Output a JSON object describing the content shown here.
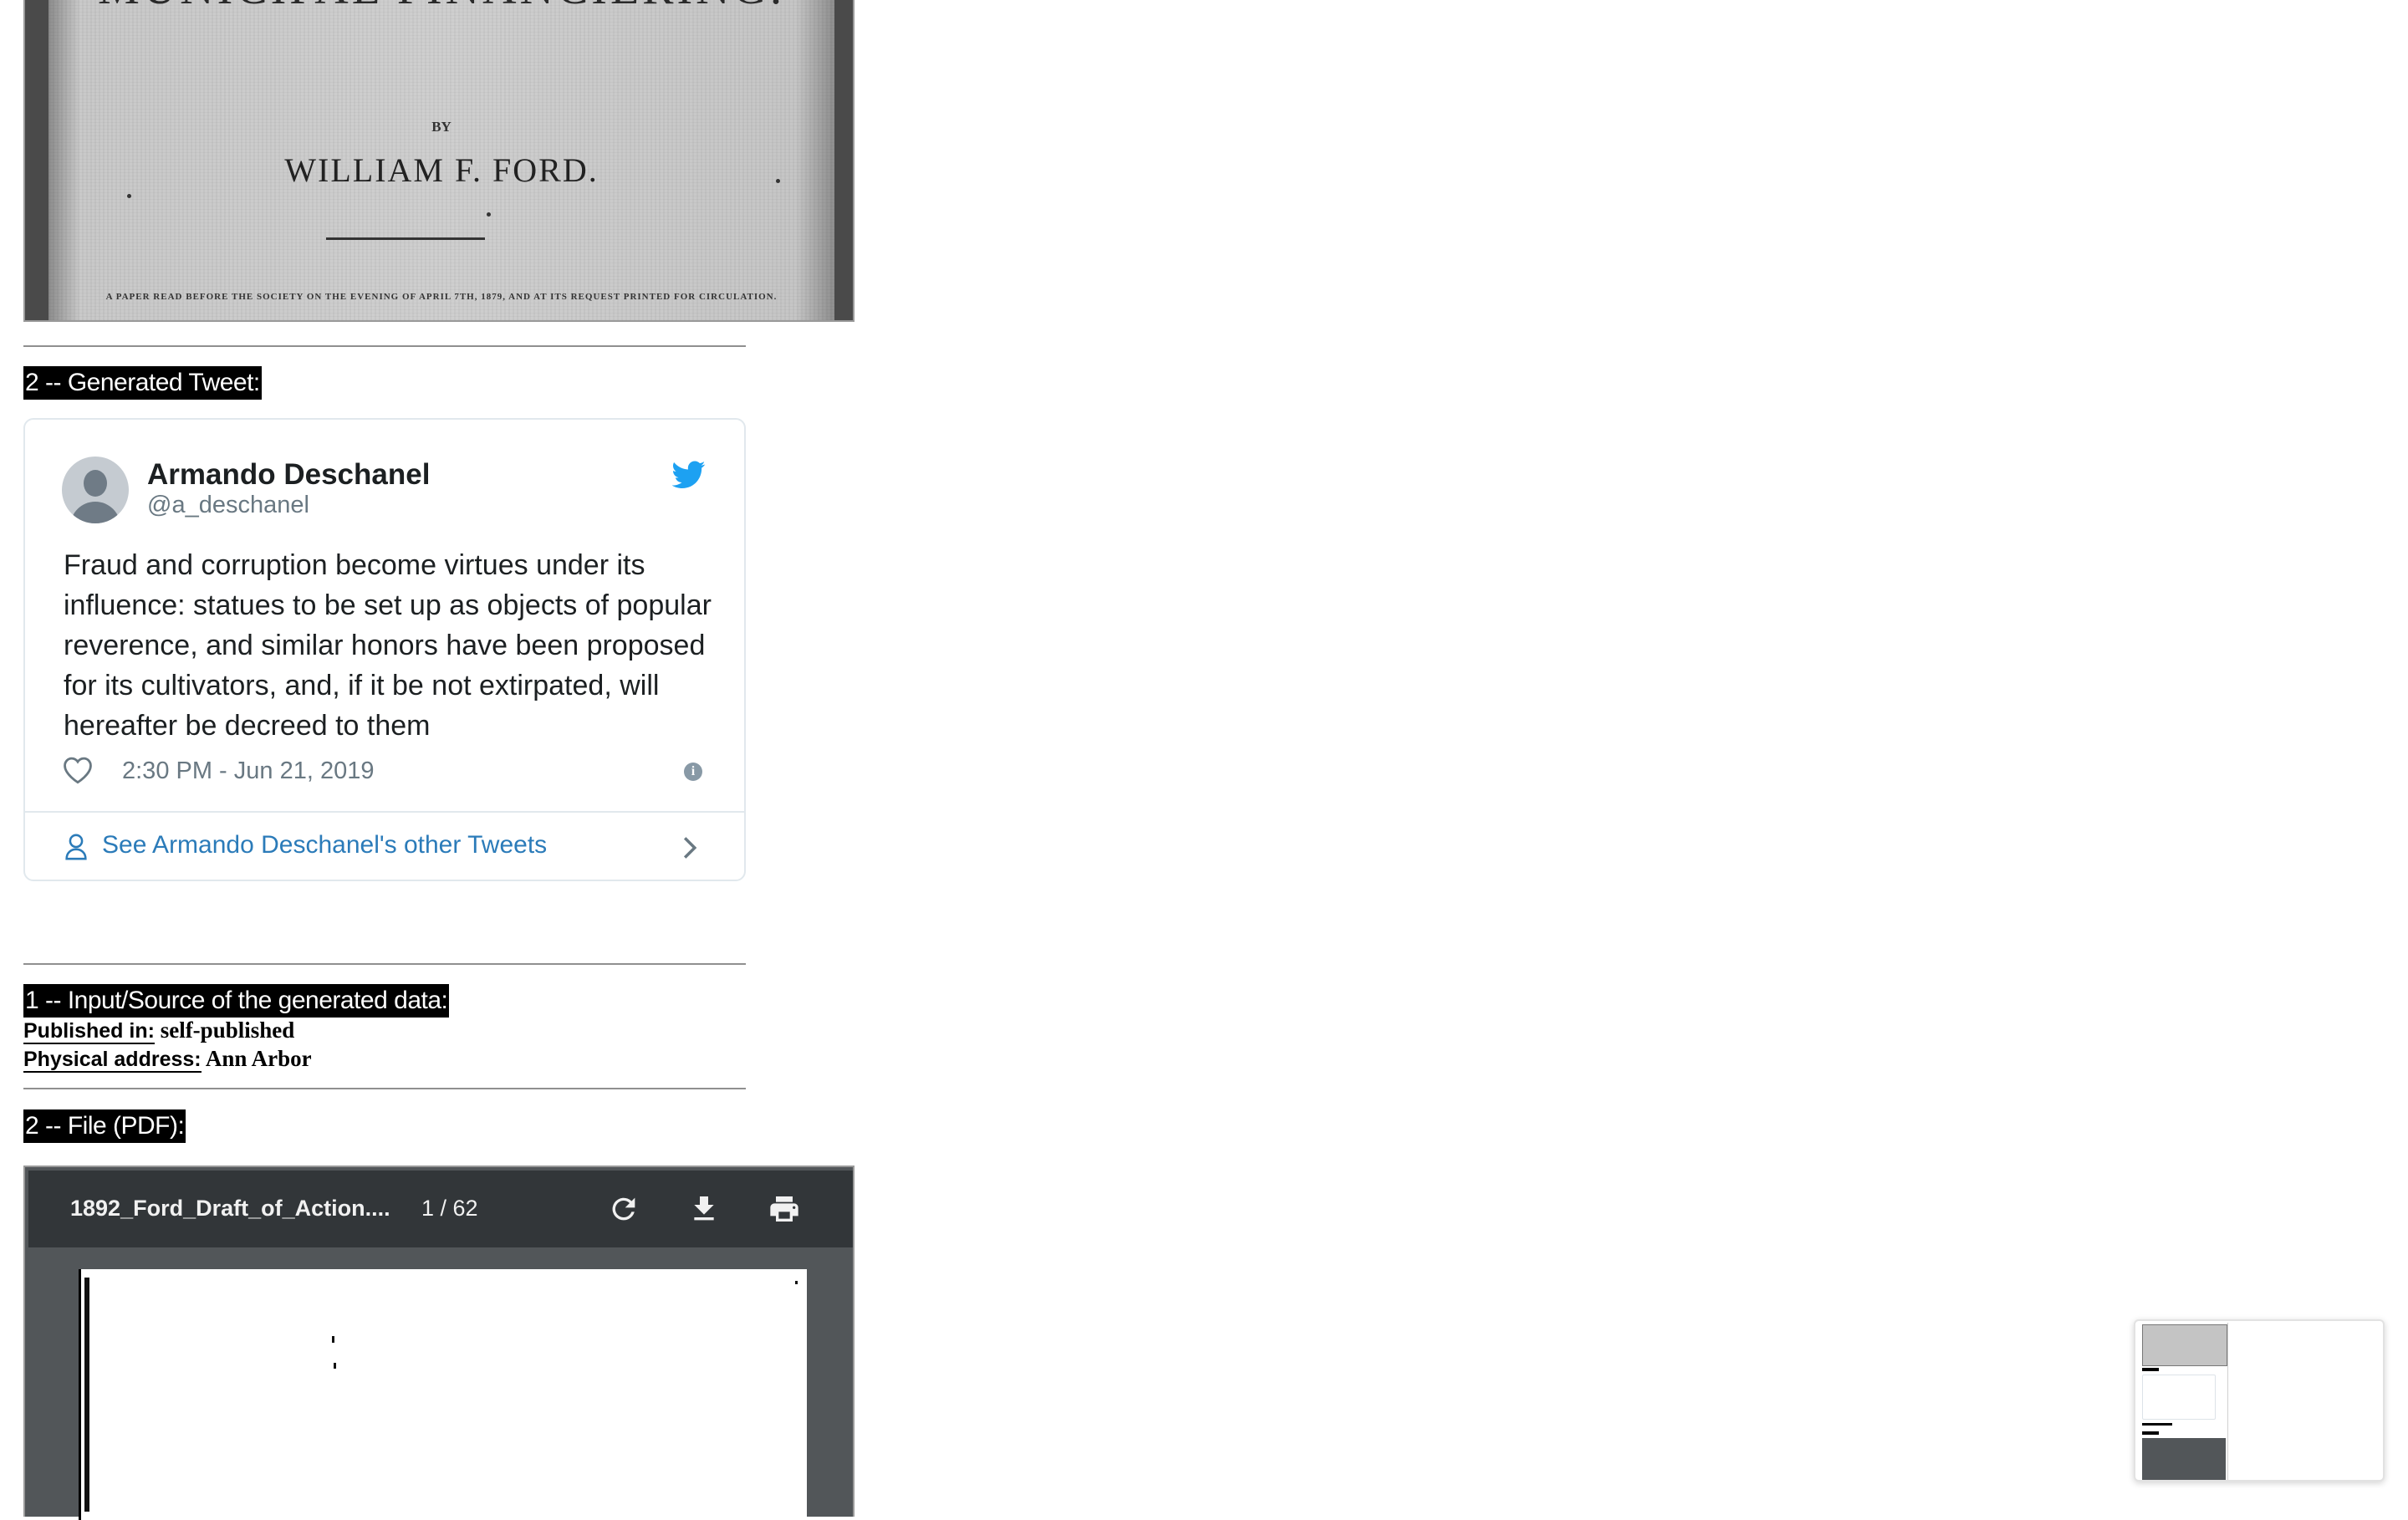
{
  "scan": {
    "title": "MUNICIPAL FINANCIERING.",
    "by": "BY",
    "author": "WILLIAM F. FORD.",
    "footnote": "A PAPER READ BEFORE THE SOCIETY ON THE EVENING OF APRIL 7TH, 1879, AND AT ITS REQUEST PRINTED FOR CIRCULATION."
  },
  "tweet_section": {
    "label": "2 -- Generated Tweet:"
  },
  "tweet": {
    "name": "Armando Deschanel",
    "handle": "@a_deschanel",
    "text": "Fraud and corruption become virtues under its influence: statues to be set up as objects of popular reverence, and similar honors have been proposed for its cultivators, and, if it be not extirpated, will hereafter be decreed to them",
    "timestamp": "2:30 PM - Jun 21, 2019",
    "more_link": "See Armando Deschanel's other Tweets",
    "icons": [
      "avatar",
      "twitter-bird-icon",
      "heart-icon",
      "info-icon",
      "user-icon",
      "chevron-right-icon"
    ],
    "accent_color": "#1da1f2",
    "link_color": "#2b7bb9"
  },
  "source_section": {
    "label": "1 -- Input/Source of the generated data:",
    "published_key": "Published in:",
    "published_value": " self-published",
    "address_key": "Physical address:",
    "address_value": " Ann Arbor"
  },
  "file_section": {
    "label": "2 -- File (PDF):"
  },
  "pdf": {
    "filename": "1892_Ford_Draft_of_Action....",
    "page_indicator": "1 / 62",
    "icons": [
      "rotate-icon",
      "download-icon",
      "print-icon"
    ]
  }
}
